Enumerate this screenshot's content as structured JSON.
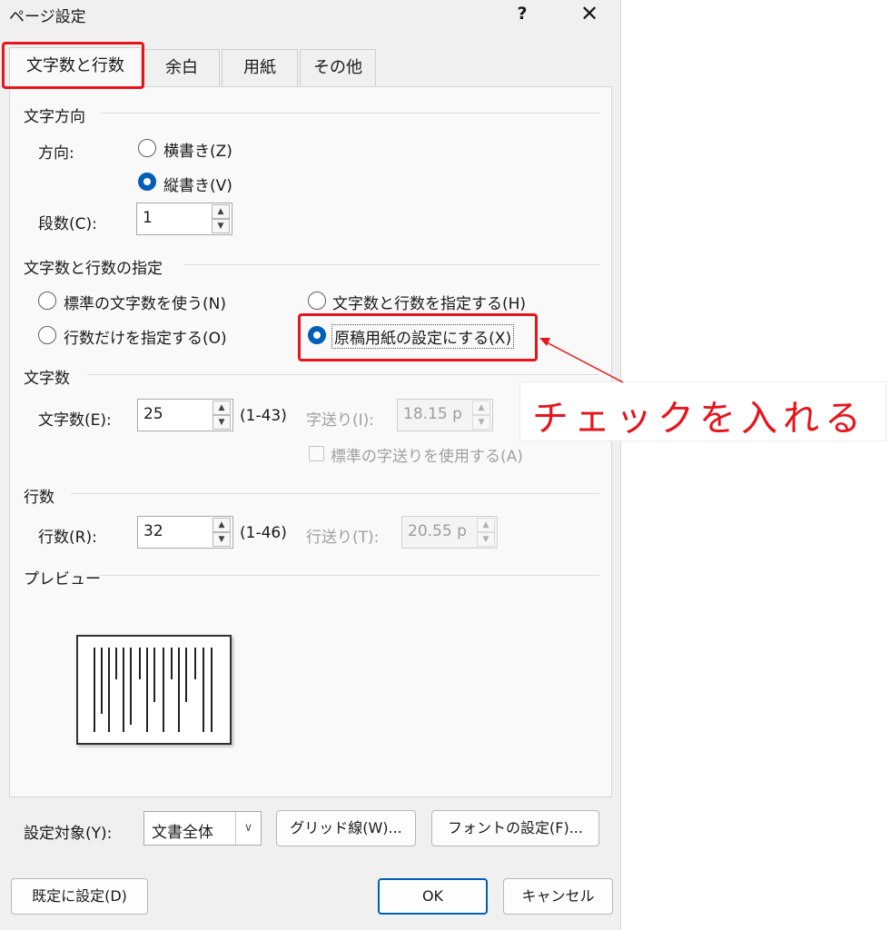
{
  "window": {
    "title": "ページ設定",
    "help": "?",
    "close": "✕"
  },
  "tabs": [
    {
      "label": "文字数と行数"
    },
    {
      "label": "余白"
    },
    {
      "label": "用紙"
    },
    {
      "label": "その他"
    }
  ],
  "text_direction": {
    "section": "文字方向",
    "direction_label": "方向:",
    "horizontal": "横書き(Z)",
    "vertical": "縦書き(V)",
    "columns_label": "段数(C):",
    "columns_value": "1"
  },
  "grid_spec": {
    "section": "文字数と行数の指定",
    "opt_standard": "標準の文字数を使う(N)",
    "opt_lines_only": "行数だけを指定する(O)",
    "opt_chars_lines": "文字数と行数を指定する(H)",
    "opt_manuscript": "原稿用紙の設定にする(X)"
  },
  "chars": {
    "section": "文字数",
    "label": "文字数(E):",
    "value": "25",
    "range": "(1-43)",
    "pitch_label": "字送り(I):",
    "pitch_value": "18.15 p",
    "std_pitch": "標準の字送りを使用する(A)"
  },
  "lines": {
    "section": "行数",
    "label": "行数(R):",
    "value": "32",
    "range": "(1-46)",
    "pitch_label": "行送り(T):",
    "pitch_value": "20.55 p"
  },
  "preview": {
    "section": "プレビュー"
  },
  "apply_to": {
    "label": "設定対象(Y):",
    "value": "文書全体",
    "grid_button": "グリッド線(W)...",
    "font_button": "フォントの設定(F)..."
  },
  "footer": {
    "default_button": "既定に設定(D)",
    "ok": "OK",
    "cancel": "キャンセル"
  },
  "annotation": {
    "text": "チェックを入れる",
    "color": "#e8141b"
  },
  "colors": {
    "accent": "#005fb8",
    "highlight": "#e8141b"
  }
}
